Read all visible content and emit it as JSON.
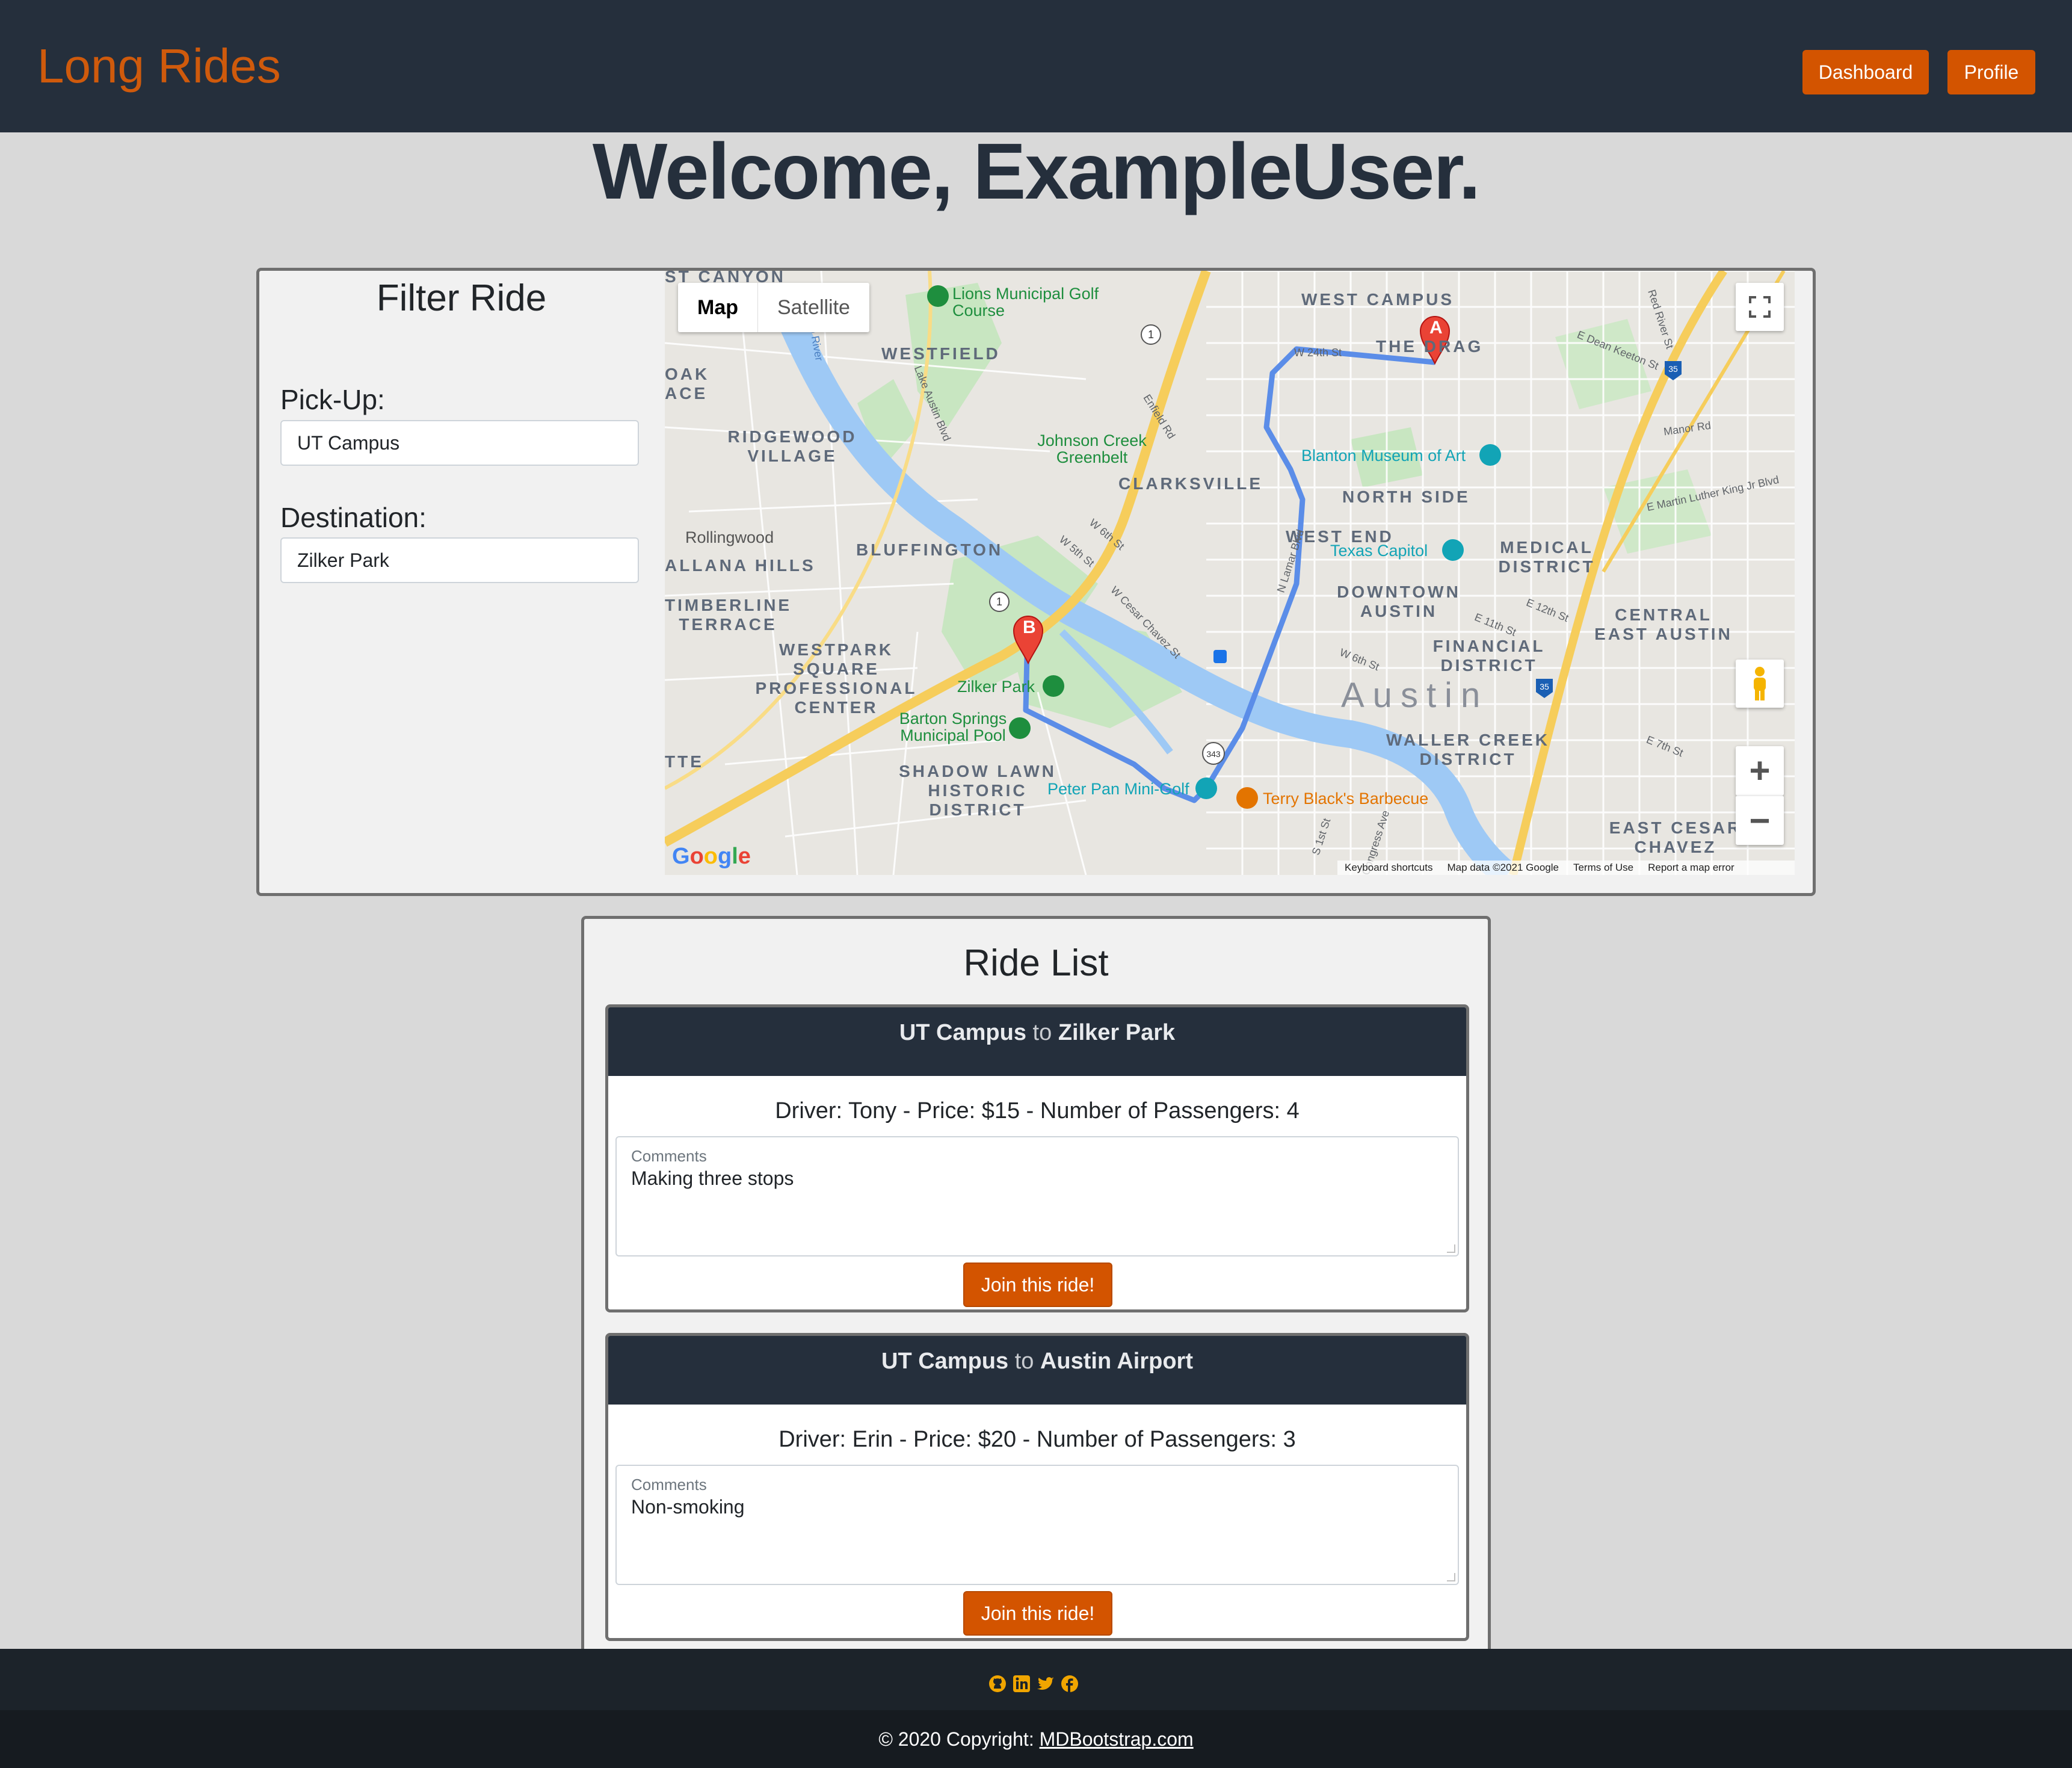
{
  "navbar": {
    "brand": "Long Rides",
    "dashboard_label": "Dashboard",
    "profile_label": "Profile",
    "accent_color": "#d35400",
    "background_color": "#252f3c"
  },
  "welcome": "Welcome, ExampleUser.",
  "filter": {
    "title": "Filter Ride",
    "pickup_label": "Pick-Up:",
    "pickup_value": "UT Campus",
    "destination_label": "Destination:",
    "destination_value": "Zilker Park"
  },
  "map": {
    "type_map": "Map",
    "type_satellite": "Satellite",
    "city_label": "Austin",
    "marker_a": "A",
    "marker_b": "B",
    "zoom_in": "+",
    "zoom_out": "−",
    "google": "Google",
    "attribution": [
      "Keyboard shortcuts",
      "Map data ©2021 Google",
      "Terms of Use",
      "Report a map error"
    ],
    "districts": [
      "WEST CAMPUS",
      "THE DRAG",
      "WESTFIELD",
      "RIDGEWOOD VILLAGE",
      "CLARKSVILLE",
      "NORTH SIDE",
      "WEST END",
      "MEDICAL DISTRICT",
      "BLUFFINGTON",
      "DOWNTOWN AUSTIN",
      "FINANCIAL DISTRICT",
      "CENTRAL EAST AUSTIN",
      "TIMBERLINE TERRACE",
      "WESTPARK SQUARE PROFESSIONAL CENTER",
      "WALLER CREEK DISTRICT",
      "SHADOW LAWN HISTORIC DISTRICT",
      "EAST CESAR CHAVEZ",
      "Rollingwood",
      "ALLANA HILLS",
      "ST CANYON",
      "OAK ACE",
      "TTE"
    ],
    "pois": [
      "Lions Municipal Golf Course",
      "Johnson Creek Greenbelt",
      "Blanton Museum of Art",
      "Texas Capitol",
      "Zilker Park",
      "Barton Springs Municipal Pool",
      "Peter Pan Mini-Golf",
      "Terry Black's Barbecue"
    ],
    "roads": [
      "W 24th St",
      "E Dean Keeton St",
      "Red River St",
      "Manor Rd",
      "E Martin Luther King Jr Blvd",
      "Enfield Rd",
      "Lake Austin Blvd",
      "W 6th St",
      "W 5th St",
      "W Cesar Chavez St",
      "N Lamar Blvd",
      "E 12th St",
      "E 11th St",
      "W 6th St",
      "E 7th St",
      "S 1st St",
      "Congress Ave",
      "Colorado River"
    ],
    "shields": [
      "1",
      "35",
      "343"
    ],
    "route_color": "#5b8de8"
  },
  "ride_list": {
    "title": "Ride List",
    "rides": [
      {
        "from": "UT Campus",
        "to_word": "to",
        "to": "Zilker Park",
        "info": "Driver: Tony - Price: $15 - Number of Passengers: 4",
        "comments_label": "Comments",
        "comments": "Making three stops",
        "join_label": "Join this ride!"
      },
      {
        "from": "UT Campus",
        "to_word": "to",
        "to": "Austin Airport",
        "info": "Driver: Erin - Price: $20 - Number of Passengers: 3",
        "comments_label": "Comments",
        "comments": "Non-smoking",
        "join_label": "Join this ride!"
      }
    ]
  },
  "footer": {
    "social_icons": [
      "github-icon",
      "linkedin-icon",
      "twitter-icon",
      "facebook-icon"
    ],
    "social_color": "#f0a500",
    "copyright": "© 2020 Copyright: ",
    "link": "MDBootstrap.com"
  }
}
